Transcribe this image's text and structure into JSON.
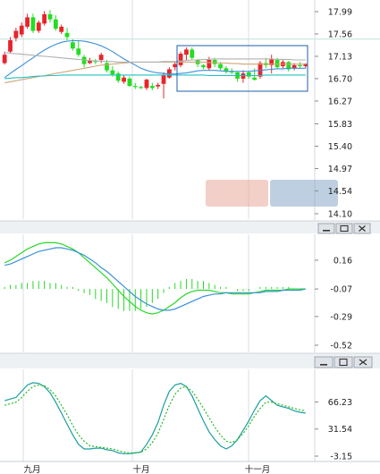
{
  "colors": {
    "up": "#e8232b",
    "down": "#22dd22",
    "ma_blue": "#3a8fd9",
    "ma_teal": "#20c0c0",
    "ma_tan": "#cfa678",
    "ma_gray": "#b0b0b0",
    "macd_green": "#27d827",
    "macd_blue": "#3a8fd9",
    "kdj_teal": "#1b9e9e",
    "kdj_green": "#22bb22",
    "grid": "#d9dde3",
    "selection_box": "#1f5fa8",
    "divider": "#e4e8ec",
    "hline": "#bfe3dc"
  },
  "window_buttons": {
    "minimize_icon": "minimize-icon",
    "restore_icon": "restore-icon",
    "close_icon": "close-icon"
  },
  "chart_data": [
    {
      "type": "candlestick",
      "panel": "price",
      "yticks": [
        "17.99",
        "17.56",
        "17.13",
        "16.70",
        "16.27",
        "15.83",
        "15.40",
        "14.97",
        "14.54",
        "14.10"
      ],
      "ylim": [
        14.1,
        17.99
      ],
      "selection_box": true,
      "series": [
        {
          "name": "",
          "type": "ohlc",
          "values": [
            [
              17.0,
              17.22,
              16.97,
              17.16
            ],
            [
              17.22,
              17.5,
              17.2,
              17.44
            ],
            [
              17.48,
              17.68,
              17.42,
              17.62
            ],
            [
              17.55,
              17.78,
              17.5,
              17.72
            ],
            [
              17.7,
              17.95,
              17.66,
              17.88
            ],
            [
              17.88,
              17.95,
              17.58,
              17.62
            ],
            [
              17.62,
              17.82,
              17.58,
              17.78
            ],
            [
              17.76,
              18.0,
              17.72,
              17.94
            ],
            [
              17.94,
              18.02,
              17.78,
              17.84
            ],
            [
              17.84,
              17.92,
              17.62,
              17.66
            ],
            [
              17.6,
              17.74,
              17.56,
              17.7
            ],
            [
              17.58,
              17.68,
              17.44,
              17.5
            ],
            [
              17.4,
              17.46,
              17.24,
              17.28
            ],
            [
              17.28,
              17.44,
              17.12,
              17.16
            ],
            [
              17.12,
              17.16,
              16.92,
              16.98
            ],
            [
              17.0,
              17.1,
              16.98,
              17.04
            ],
            [
              17.04,
              17.08,
              16.98,
              17.02
            ],
            [
              17.06,
              17.2,
              17.0,
              17.16
            ],
            [
              17.0,
              17.06,
              16.82,
              16.86
            ],
            [
              16.86,
              16.94,
              16.74,
              16.78
            ],
            [
              16.8,
              16.84,
              16.62,
              16.66
            ],
            [
              16.64,
              16.76,
              16.6,
              16.72
            ],
            [
              16.7,
              16.74,
              16.54,
              16.56
            ],
            [
              16.56,
              16.62,
              16.5,
              16.54
            ],
            [
              16.54,
              16.56,
              16.5,
              16.52
            ],
            [
              16.52,
              16.7,
              16.48,
              16.68
            ],
            [
              16.56,
              16.62,
              16.48,
              16.52
            ],
            [
              16.55,
              16.62,
              16.5,
              16.58
            ],
            [
              16.6,
              16.82,
              16.32,
              16.76
            ],
            [
              16.72,
              16.92,
              16.7,
              16.88
            ],
            [
              16.92,
              17.02,
              16.86,
              16.98
            ],
            [
              16.96,
              17.22,
              16.92,
              17.18
            ],
            [
              17.16,
              17.3,
              17.05,
              17.26
            ],
            [
              17.26,
              17.3,
              17.06,
              17.1
            ],
            [
              17.06,
              17.08,
              16.92,
              16.98
            ],
            [
              16.96,
              16.98,
              16.88,
              16.92
            ],
            [
              16.9,
              17.12,
              16.86,
              17.06
            ],
            [
              17.06,
              17.1,
              16.92,
              16.98
            ],
            [
              16.98,
              17.02,
              16.86,
              16.9
            ],
            [
              16.9,
              16.94,
              16.8,
              16.84
            ],
            [
              16.84,
              16.9,
              16.78,
              16.82
            ],
            [
              16.82,
              16.84,
              16.64,
              16.7
            ],
            [
              16.7,
              16.86,
              16.62,
              16.8
            ],
            [
              16.82,
              16.84,
              16.7,
              16.74
            ],
            [
              16.72,
              16.9,
              16.66,
              16.68
            ],
            [
              16.74,
              17.04,
              16.7,
              17.0
            ],
            [
              17.0,
              17.1,
              16.9,
              16.96
            ],
            [
              16.96,
              17.16,
              16.8,
              17.08
            ],
            [
              17.06,
              17.1,
              16.88,
              16.92
            ],
            [
              16.94,
              17.06,
              16.9,
              17.02
            ],
            [
              17.02,
              17.04,
              16.84,
              16.88
            ],
            [
              16.9,
              17.0,
              16.86,
              16.96
            ],
            [
              16.96,
              17.02,
              16.9,
              16.94
            ],
            [
              16.94,
              17.0,
              16.9,
              16.98
            ]
          ]
        },
        {
          "name": "",
          "type": "line",
          "color_key": "ma_blue",
          "values": [
            16.72,
            16.8,
            16.88,
            16.95,
            17.03,
            17.1,
            17.18,
            17.25,
            17.31,
            17.36,
            17.4,
            17.42,
            17.43,
            17.43,
            17.42,
            17.4,
            17.37,
            17.33,
            17.28,
            17.22,
            17.15,
            17.08,
            17.02,
            16.96,
            16.9,
            16.86,
            16.83,
            16.81,
            16.8,
            16.79,
            16.79,
            16.8,
            16.81,
            16.83,
            16.85,
            16.86,
            16.86,
            16.86,
            16.85,
            16.84,
            16.84,
            16.84,
            16.84,
            16.84,
            16.85,
            16.86,
            16.87,
            16.88,
            16.89,
            16.89,
            16.9,
            16.9,
            16.9,
            16.9
          ]
        },
        {
          "name": "",
          "type": "line",
          "color_key": "ma_tan",
          "values": [
            16.62,
            16.64,
            16.66,
            16.68,
            16.7,
            16.72,
            16.74,
            16.76,
            16.78,
            16.8,
            16.82,
            16.84,
            16.86,
            16.88,
            16.9,
            16.92,
            16.94,
            16.96,
            16.97,
            16.98,
            16.99,
            17.0,
            17.01,
            17.02,
            17.02,
            17.02,
            17.02,
            17.02,
            17.02,
            17.02,
            17.02,
            17.02,
            17.02,
            17.02,
            17.02,
            17.02,
            17.01,
            17.01,
            17.0,
            17.0,
            16.99,
            16.99,
            16.98,
            16.98,
            16.98,
            16.98,
            16.98,
            16.98,
            16.98,
            16.98,
            16.98,
            16.98,
            16.98,
            16.98
          ]
        },
        {
          "name": "",
          "type": "line",
          "color_key": "ma_gray",
          "values": [
            17.2,
            17.19,
            17.18,
            17.17,
            17.16,
            17.15,
            17.14,
            17.13,
            17.12,
            17.11,
            17.1,
            17.09,
            17.08,
            17.07,
            17.06,
            17.05,
            17.04,
            17.04,
            17.03,
            17.03,
            17.02,
            17.02,
            17.02,
            17.02,
            17.02,
            17.02,
            17.02,
            17.02,
            17.03,
            17.03,
            17.03,
            17.04,
            17.05,
            17.06,
            17.06,
            17.07,
            17.07,
            17.08,
            17.08,
            17.08,
            17.08,
            17.08,
            17.08,
            17.08,
            17.08,
            17.08,
            17.08,
            17.08,
            17.07,
            17.07,
            17.07,
            17.06,
            17.06,
            17.06
          ]
        },
        {
          "name": "",
          "type": "line",
          "color_key": "ma_teal",
          "values": [
            16.7,
            16.71,
            16.72,
            16.72,
            16.73,
            16.74,
            16.75,
            16.75,
            16.76,
            16.76,
            16.77,
            16.77,
            16.77,
            16.77,
            16.77,
            16.77,
            16.77,
            16.77,
            16.77,
            16.77,
            16.77,
            16.77,
            16.77,
            16.77,
            16.77,
            16.77,
            16.77,
            16.77,
            16.77,
            16.77,
            16.77,
            16.77,
            16.77,
            16.77,
            16.77,
            16.77,
            16.76,
            16.76,
            16.76,
            16.76,
            16.76,
            16.76,
            16.76,
            16.76,
            16.76,
            16.76,
            16.77,
            16.77,
            16.77,
            16.77,
            16.77,
            16.77,
            16.77,
            16.77
          ]
        }
      ]
    },
    {
      "type": "macd",
      "panel": "macd",
      "yticks": [
        "0.16",
        "-0.07",
        "-0.29",
        "-0.52"
      ],
      "ylim": [
        -0.52,
        0.31
      ],
      "series": [
        {
          "name": "",
          "type": "line",
          "color_key": "macd_green",
          "values": [
            0.14,
            0.16,
            0.19,
            0.22,
            0.25,
            0.27,
            0.29,
            0.3,
            0.3,
            0.3,
            0.29,
            0.27,
            0.25,
            0.22,
            0.18,
            0.14,
            0.1,
            0.06,
            0.02,
            -0.03,
            -0.08,
            -0.13,
            -0.17,
            -0.21,
            -0.24,
            -0.26,
            -0.27,
            -0.26,
            -0.24,
            -0.21,
            -0.18,
            -0.14,
            -0.11,
            -0.09,
            -0.08,
            -0.08,
            -0.08,
            -0.09,
            -0.1,
            -0.1,
            -0.11,
            -0.11,
            -0.11,
            -0.11,
            -0.1,
            -0.09,
            -0.08,
            -0.08,
            -0.08,
            -0.08,
            -0.07,
            -0.07,
            -0.07,
            -0.07
          ]
        },
        {
          "name": "",
          "type": "line",
          "color_key": "macd_blue",
          "values": [
            0.12,
            0.13,
            0.15,
            0.17,
            0.19,
            0.21,
            0.23,
            0.24,
            0.25,
            0.26,
            0.26,
            0.25,
            0.24,
            0.22,
            0.2,
            0.17,
            0.14,
            0.1,
            0.07,
            0.03,
            -0.01,
            -0.05,
            -0.09,
            -0.13,
            -0.16,
            -0.19,
            -0.21,
            -0.23,
            -0.24,
            -0.24,
            -0.23,
            -0.21,
            -0.19,
            -0.17,
            -0.15,
            -0.13,
            -0.12,
            -0.11,
            -0.11,
            -0.1,
            -0.1,
            -0.1,
            -0.1,
            -0.1,
            -0.1,
            -0.1,
            -0.09,
            -0.09,
            -0.09,
            -0.08,
            -0.08,
            -0.08,
            -0.08,
            -0.07
          ]
        },
        {
          "name": "",
          "type": "histogram",
          "color_key": "macd_green",
          "values": [
            0.01,
            0.02,
            0.02,
            0.03,
            0.03,
            0.04,
            0.04,
            0.04,
            0.03,
            0.03,
            0.02,
            0.01,
            0.01,
            -0.01,
            -0.02,
            -0.03,
            -0.05,
            -0.06,
            -0.07,
            -0.09,
            -0.1,
            -0.11,
            -0.11,
            -0.11,
            -0.1,
            -0.09,
            -0.07,
            -0.05,
            -0.02,
            0.01,
            0.03,
            0.04,
            0.05,
            0.05,
            0.04,
            0.04,
            0.03,
            0.02,
            0.01,
            0.01,
            0.0,
            -0.01,
            -0.01,
            -0.01,
            0.0,
            0.01,
            0.01,
            0.01,
            0.01,
            0.01,
            0.01,
            0.0,
            0.0,
            0.0
          ]
        }
      ]
    },
    {
      "type": "kdj",
      "panel": "kdj",
      "yticks": [
        "66.23",
        "31.54",
        "-3.15"
      ],
      "ylim": [
        -3.15,
        100
      ],
      "series": [
        {
          "name": "",
          "type": "line",
          "color_key": "kdj_teal",
          "values": [
            68,
            70,
            72,
            80,
            88,
            91,
            90,
            86,
            78,
            66,
            52,
            38,
            24,
            12,
            6,
            6,
            7,
            7,
            5,
            4,
            1,
            0,
            0,
            1,
            2,
            12,
            24,
            40,
            62,
            80,
            88,
            90,
            86,
            74,
            58,
            42,
            28,
            18,
            10,
            6,
            10,
            18,
            30,
            42,
            56,
            68,
            74,
            68,
            62,
            60,
            58,
            55,
            53,
            52
          ]
        },
        {
          "name": "",
          "type": "line",
          "color_key": "kdj_green",
          "values": [
            62,
            64,
            66,
            72,
            80,
            86,
            88,
            87,
            82,
            74,
            62,
            50,
            36,
            24,
            16,
            10,
            9,
            8,
            7,
            6,
            4,
            2,
            1,
            1,
            2,
            6,
            14,
            26,
            44,
            62,
            76,
            84,
            86,
            80,
            70,
            58,
            46,
            34,
            24,
            16,
            14,
            18,
            26,
            36,
            48,
            58,
            66,
            66,
            64,
            62,
            60,
            58,
            56,
            55
          ]
        }
      ]
    },
    {
      "type": "time_axis",
      "panel": "x",
      "labels": [
        "九月",
        "十月",
        "十一月"
      ]
    }
  ]
}
